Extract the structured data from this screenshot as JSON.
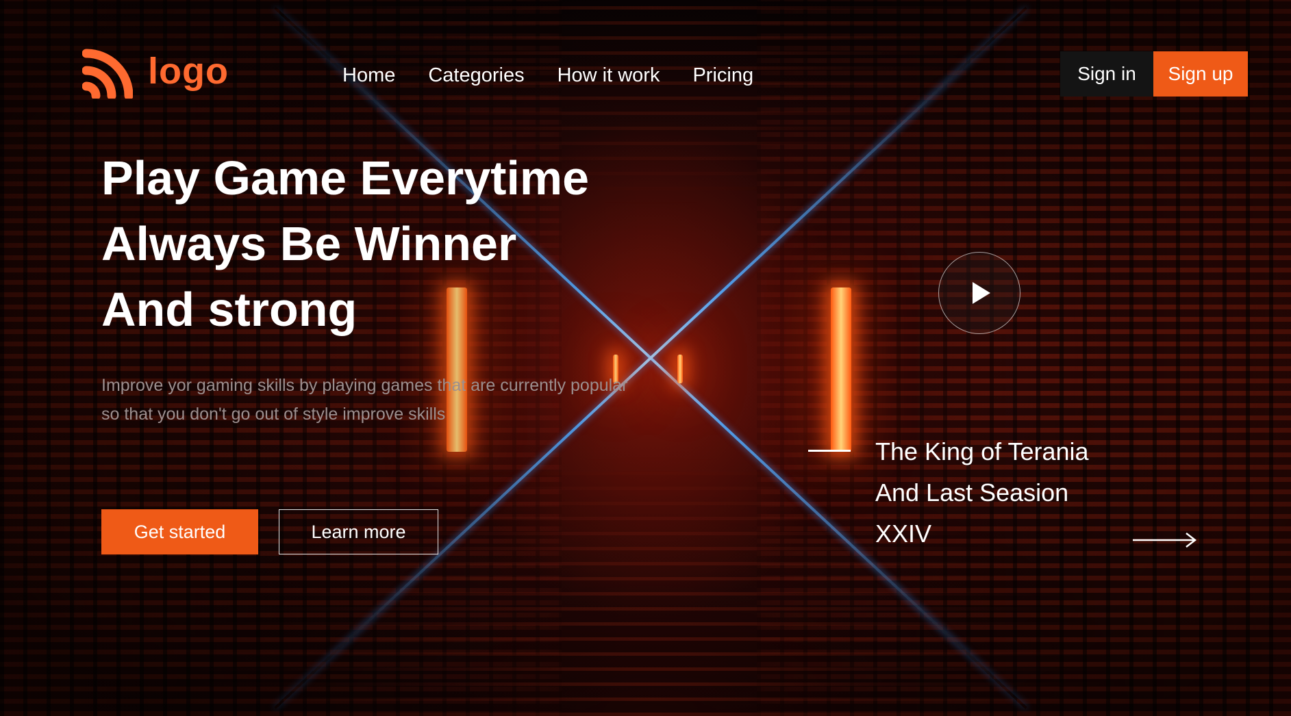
{
  "brand": {
    "logo_text": "logo",
    "accent_color": "#ef5a17",
    "logo_color": "#ff6a30",
    "icon": "rss-icon"
  },
  "nav": {
    "items": [
      {
        "label": "Home"
      },
      {
        "label": "Categories"
      },
      {
        "label": "How it work"
      },
      {
        "label": "Pricing"
      }
    ]
  },
  "auth": {
    "sign_in_label": "Sign in",
    "sign_up_label": "Sign up"
  },
  "hero": {
    "title_lines": [
      "Play Game Everytime",
      "Always Be Winner",
      "And strong"
    ],
    "description": "Improve yor gaming skills by playing games that are currently popular so that you don't go out of style improve skills",
    "primary_cta": "Get started",
    "secondary_cta": "Learn more"
  },
  "feature": {
    "title_lines": [
      "The King of Terania",
      "And Last Seasion",
      "XXIV"
    ],
    "play_icon": "play-icon",
    "arrow_icon": "arrow-right-icon"
  }
}
